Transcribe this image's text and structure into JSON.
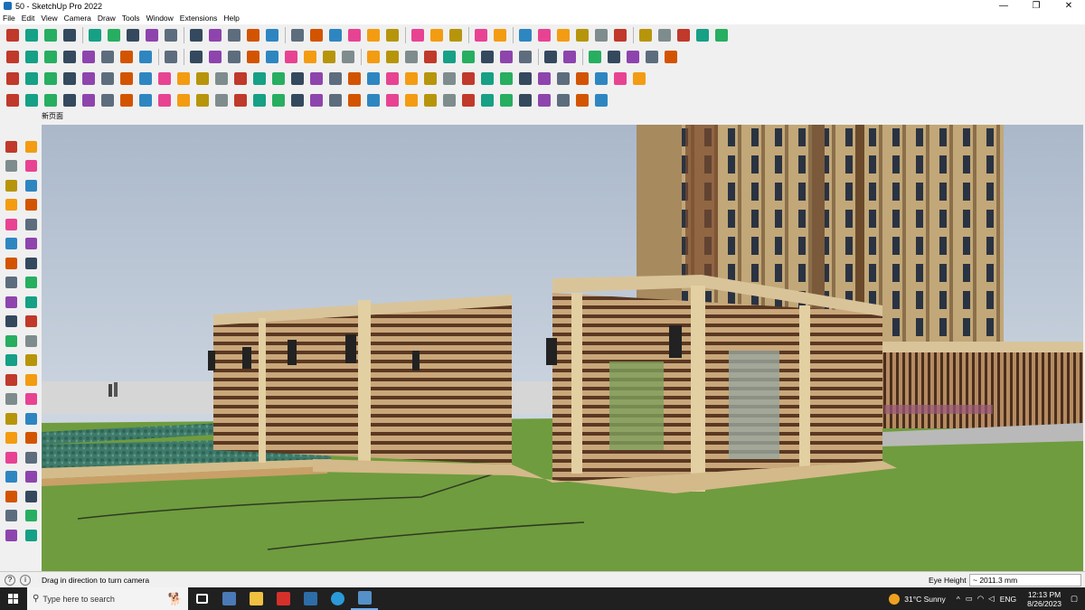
{
  "window": {
    "title": "50 - SketchUp Pro 2022",
    "minimize": "—",
    "maximize": "❐",
    "close": "✕"
  },
  "menu": [
    "File",
    "Edit",
    "View",
    "Camera",
    "Draw",
    "Tools",
    "Window",
    "Extensions",
    "Help"
  ],
  "scene_tab": "新页面",
  "status": {
    "message": "Drag in direction to turn camera",
    "measure_label": "Eye Height",
    "measure_value": "~ 2011.3 mm"
  },
  "taskbar": {
    "search_placeholder": "Type here to search",
    "weather": "31°C  Sunny",
    "language": "ENG",
    "time": "12:13 PM",
    "date": "8/26/2023"
  },
  "colors": {
    "sky": "#c9d4e2",
    "grass": "#6f9c3e",
    "wood": "#7a4a2c",
    "stone": "#d9c49a",
    "tower": "#b59a6e"
  }
}
